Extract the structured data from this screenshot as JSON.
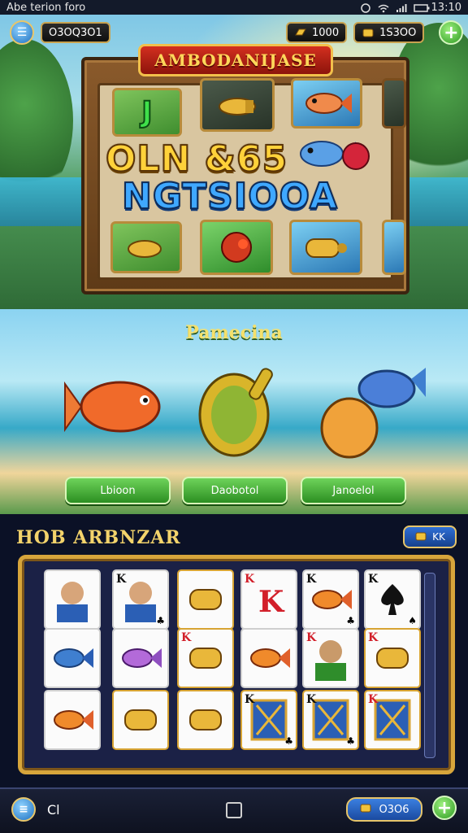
{
  "status_bar": {
    "left_text": "Abe terion foro",
    "time": "13:10"
  },
  "hud": {
    "left_counter": "O3OQ3O1",
    "currency_1": "1000",
    "currency_2": "1S3OO"
  },
  "top_game": {
    "banner_title": "AMBODANIJASE",
    "line_1": "OLN &65",
    "line_2": "NGTSIOOA",
    "tile_letter": "J"
  },
  "mid_scene": {
    "title": "Pamecina",
    "buttons": [
      "Lbioon",
      "Daobotol",
      "Janoelol"
    ]
  },
  "panel": {
    "title": "HOB ARBNZAR",
    "chip_label": "KK"
  },
  "cards": [
    {
      "rank": "",
      "suit": "",
      "type": "portrait-man"
    },
    {
      "rank": "K",
      "suit": "♣",
      "type": "portrait-man"
    },
    {
      "rank": "",
      "suit": "",
      "type": "gold-item"
    },
    {
      "rank": "K",
      "suit": "",
      "type": "red-K"
    },
    {
      "rank": "K",
      "suit": "♣",
      "type": "fish"
    },
    {
      "rank": "K",
      "suit": "♠",
      "type": "spade"
    },
    {
      "rank": "",
      "suit": "",
      "type": "blue-fish"
    },
    {
      "rank": "",
      "suit": "",
      "type": "purple-fish"
    },
    {
      "rank": "K",
      "suit": "",
      "type": "gold-item"
    },
    {
      "rank": "",
      "suit": "",
      "type": "fish"
    },
    {
      "rank": "K",
      "suit": "",
      "type": "portrait-green"
    },
    {
      "rank": "K",
      "suit": "",
      "type": "gold-item"
    },
    {
      "rank": "",
      "suit": "",
      "type": "fish"
    },
    {
      "rank": "",
      "suit": "",
      "type": "gold-item"
    },
    {
      "rank": "",
      "suit": "",
      "type": "gold-item"
    },
    {
      "rank": "K",
      "suit": "♣",
      "type": "pattern"
    },
    {
      "rank": "K",
      "suit": "♣",
      "type": "pattern"
    },
    {
      "rank": "K",
      "suit": "",
      "type": "pattern"
    }
  ],
  "bottom_bar": {
    "label": "Cl",
    "pill_value": "O3O6"
  },
  "colors": {
    "gold": "#d7a53b",
    "green_button": "#2c8f22",
    "blue_button": "#1a4aa0"
  }
}
